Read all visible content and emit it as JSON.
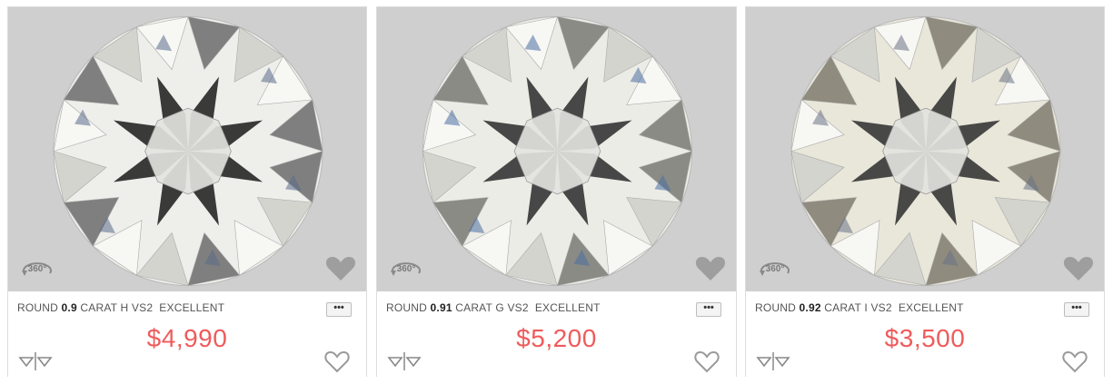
{
  "cards": [
    {
      "shape": "ROUND",
      "carat": "0.9",
      "carat_label": "CARAT",
      "color": "H",
      "clarity": "VS2",
      "cut": "EXCELLENT",
      "price": "$4,990",
      "more_label": "•••",
      "badge_label": "360°",
      "icons": [
        "360-view-icon",
        "favorite-overlay-icon",
        "compare-icon",
        "heart-icon"
      ]
    },
    {
      "shape": "ROUND",
      "carat": "0.91",
      "carat_label": "CARAT",
      "color": "G",
      "clarity": "VS2",
      "cut": "EXCELLENT",
      "price": "$5,200",
      "more_label": "•••",
      "badge_label": "360°",
      "icons": [
        "360-view-icon",
        "favorite-overlay-icon",
        "compare-icon",
        "heart-icon"
      ]
    },
    {
      "shape": "ROUND",
      "carat": "0.92",
      "carat_label": "CARAT",
      "color": "I",
      "clarity": "VS2",
      "cut": "EXCELLENT",
      "price": "$3,500",
      "more_label": "•••",
      "badge_label": "360°",
      "icons": [
        "360-view-icon",
        "favorite-overlay-icon",
        "compare-icon",
        "heart-icon"
      ]
    }
  ],
  "colors": {
    "price": "#ef5b5b",
    "image_background": "#cfcfcf",
    "card_border": "#dcdcdc"
  }
}
